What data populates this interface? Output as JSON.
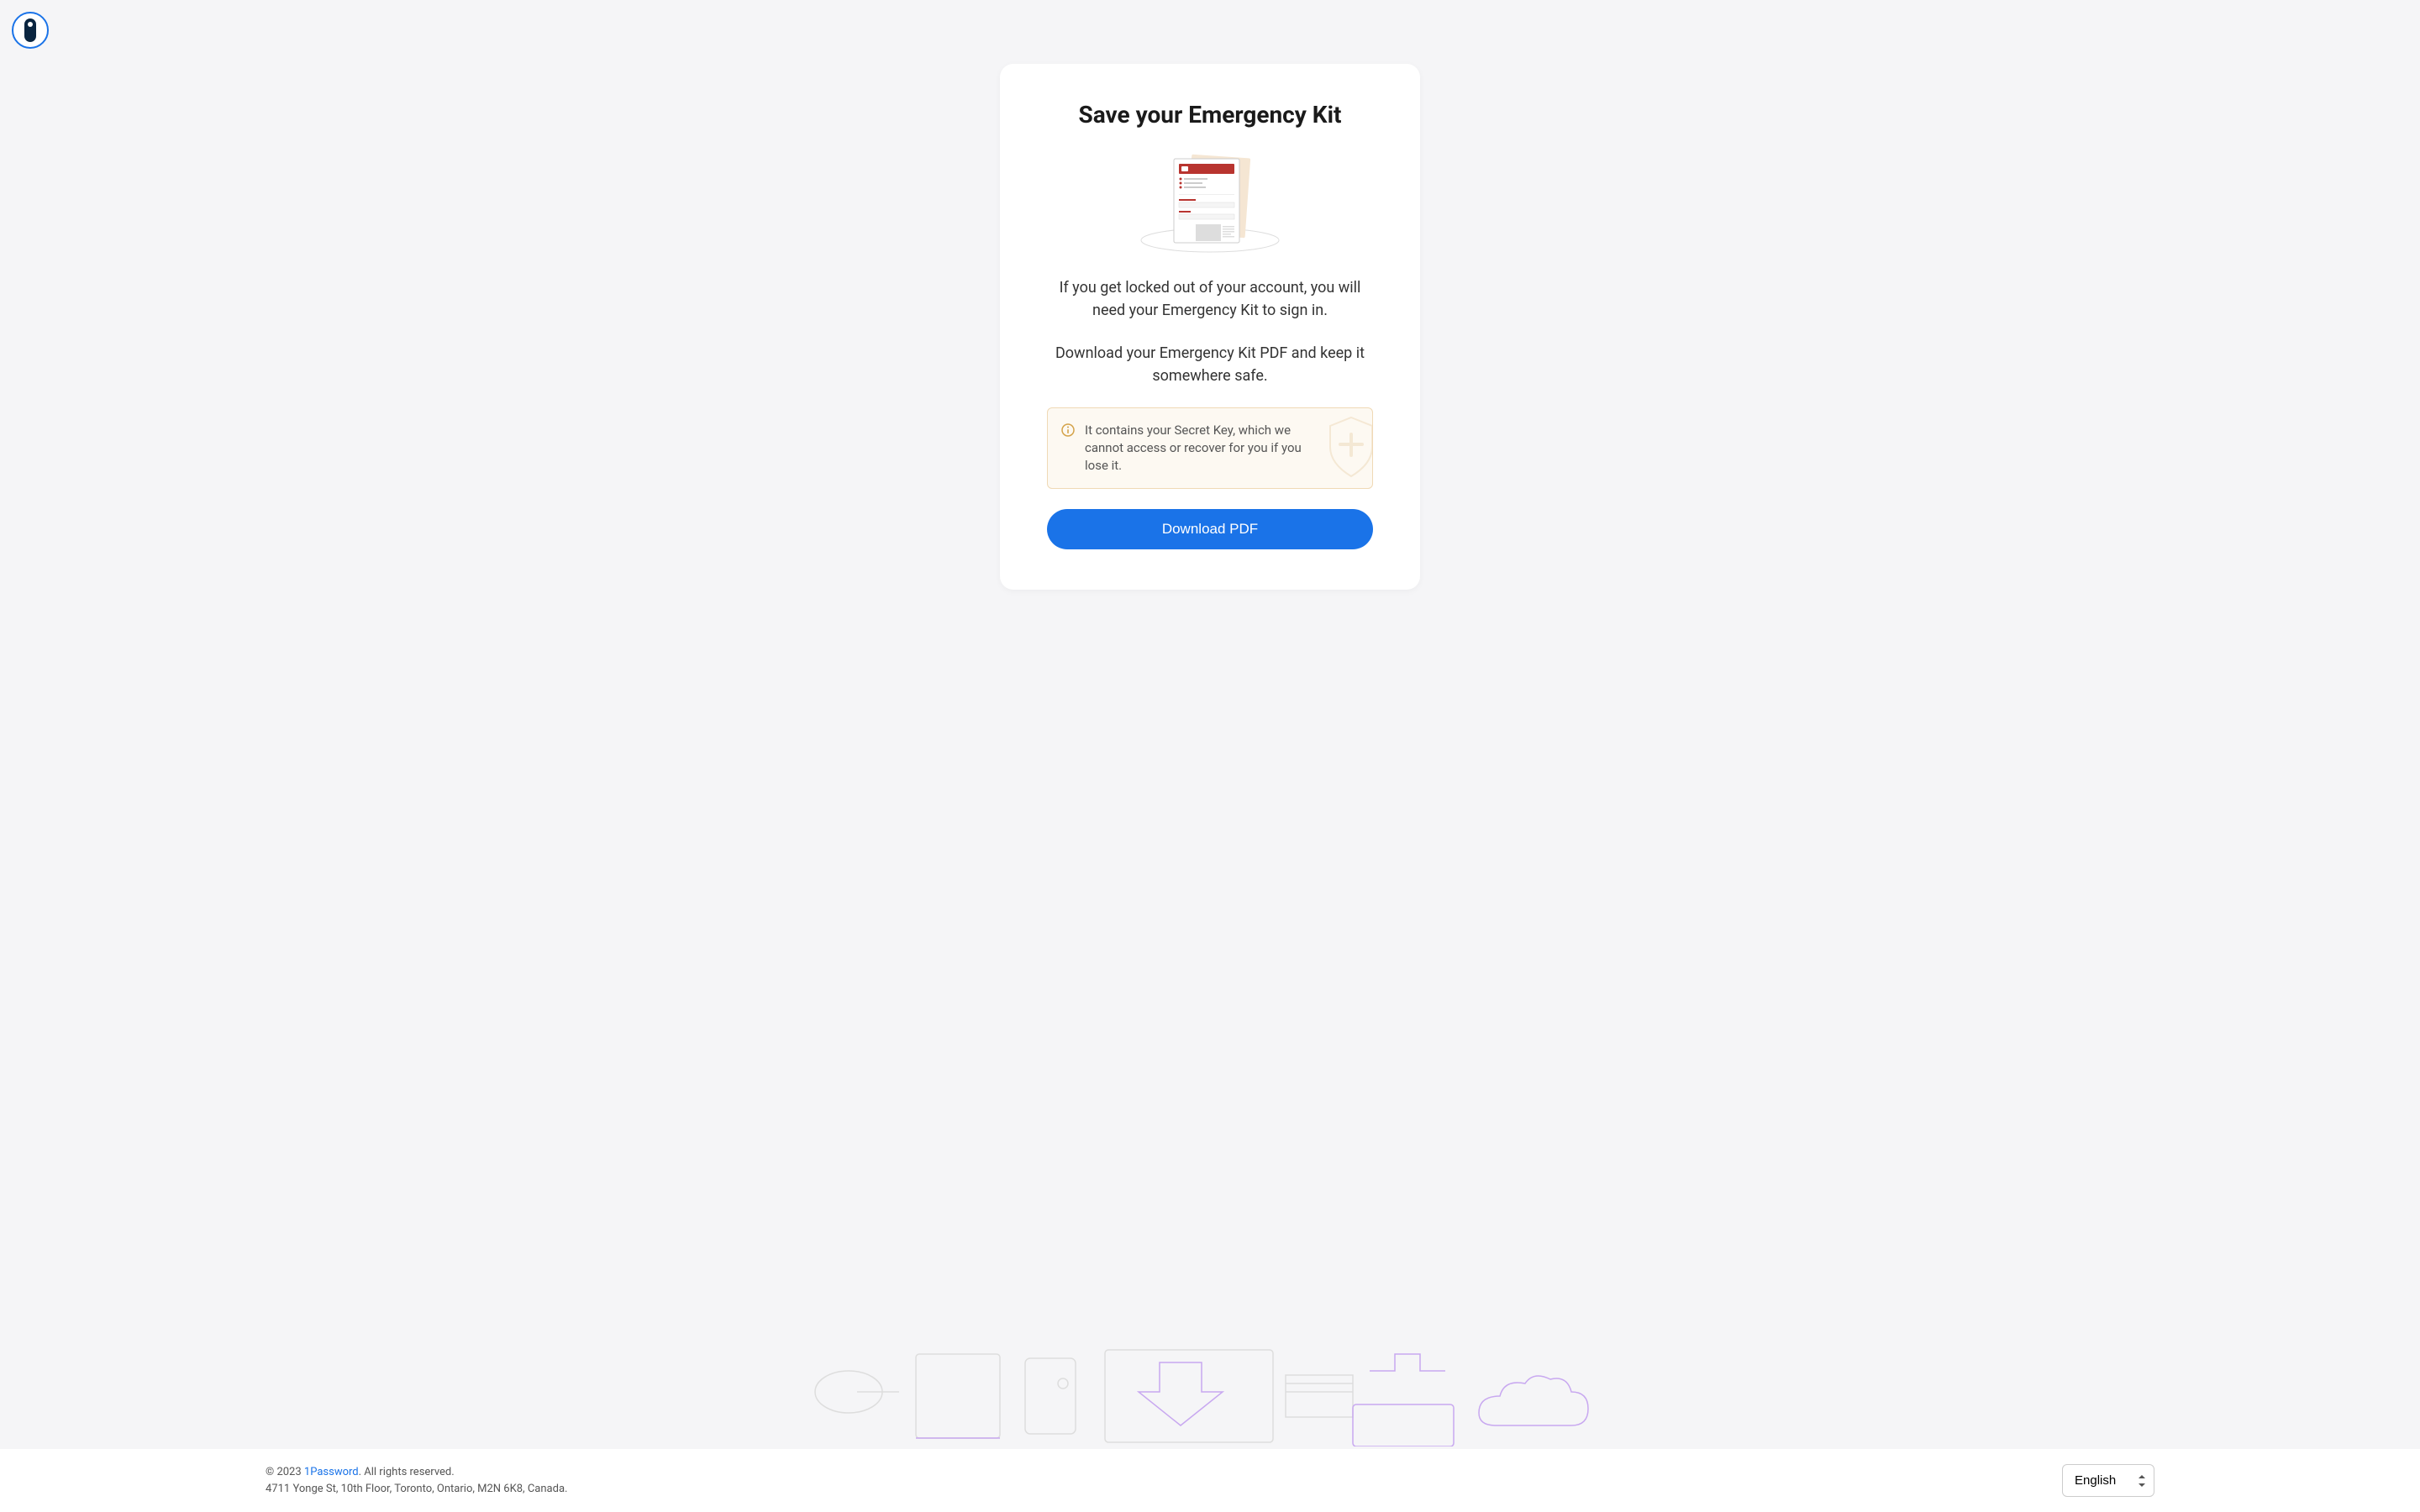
{
  "card": {
    "title": "Save your Emergency Kit",
    "description1": "If you get locked out of your account, you will need your Emergency Kit to sign in.",
    "description2": "Download your Emergency Kit PDF and keep it somewhere safe.",
    "info_text": "It contains your Secret Key, which we cannot access or recover for you if you lose it.",
    "download_button": "Download PDF"
  },
  "footer": {
    "copyright_prefix": "© 2023 ",
    "brand": "1Password",
    "copyright_suffix": ". All rights reserved.",
    "address": "4711 Yonge St, 10th Floor, Toronto, Ontario, M2N 6K8, Canada.",
    "language": "English"
  }
}
